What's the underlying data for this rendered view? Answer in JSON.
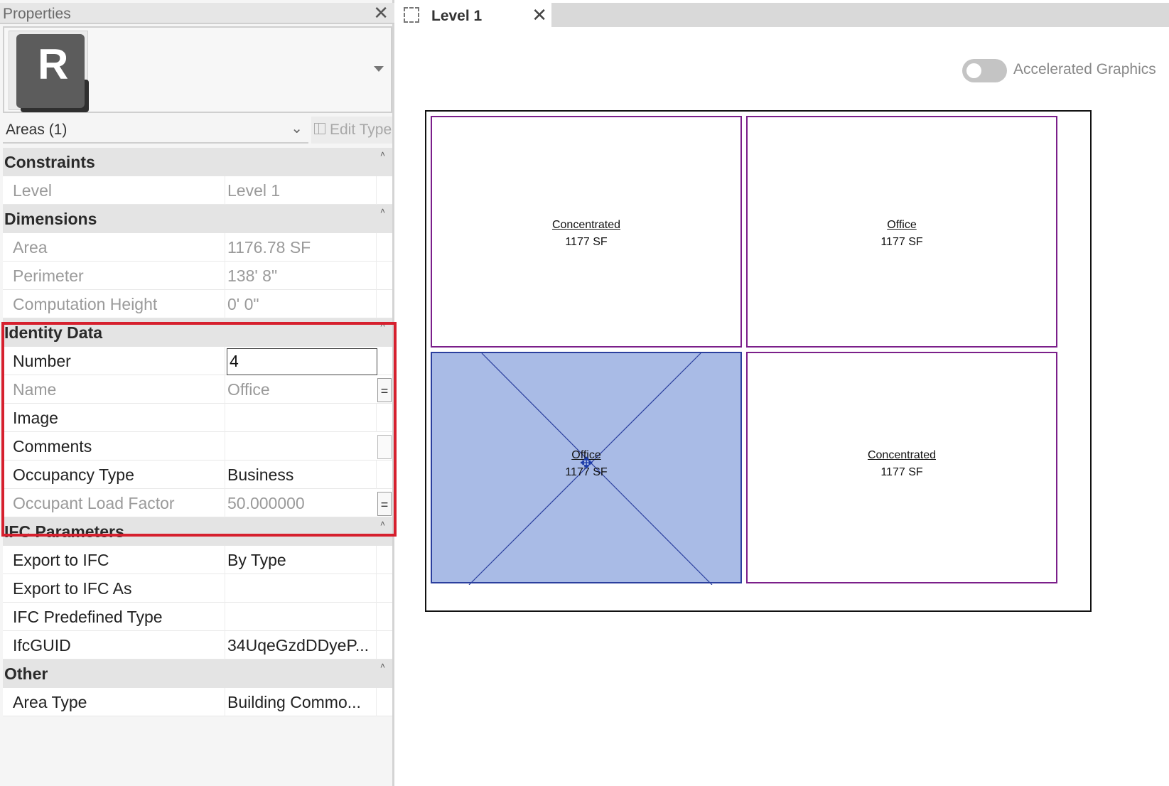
{
  "properties_panel": {
    "title": "Properties",
    "close_icon": "close-icon",
    "type_selector": {
      "logo_letter": "R",
      "dropdown_icon": "caret-down-icon"
    },
    "filter": {
      "label": "Areas (1)",
      "edit_type_label": "Edit Type"
    },
    "groups": [
      {
        "label": "Constraints",
        "rows": [
          {
            "name": "Level",
            "value": "Level 1",
            "readonly": true
          }
        ]
      },
      {
        "label": "Dimensions",
        "rows": [
          {
            "name": "Area",
            "value": "1176.78 SF",
            "readonly": true
          },
          {
            "name": "Perimeter",
            "value": "138'  8\"",
            "readonly": true
          },
          {
            "name": "Computation Height",
            "value": "0'  0\"",
            "readonly": true
          }
        ]
      },
      {
        "label": "Identity Data",
        "rows": [
          {
            "name": "Number",
            "value": "4",
            "readonly": false
          },
          {
            "name": "Name",
            "value": "Office",
            "readonly": true,
            "button": "="
          },
          {
            "name": "Image",
            "value": "",
            "readonly": false
          },
          {
            "name": "Comments",
            "value": "",
            "readonly": false
          },
          {
            "name": "Occupancy Type",
            "value": "Business",
            "readonly": false
          },
          {
            "name": "Occupant Load Factor",
            "value": "50.000000",
            "readonly": true,
            "button": "="
          }
        ]
      },
      {
        "label": "IFC Parameters",
        "rows": [
          {
            "name": "Export to IFC",
            "value": "By Type",
            "readonly": false
          },
          {
            "name": "Export to IFC As",
            "value": "",
            "readonly": false
          },
          {
            "name": "IFC Predefined Type",
            "value": "",
            "readonly": false
          },
          {
            "name": "IfcGUID",
            "value": "34UqeGzdDDyeP...",
            "readonly": false
          }
        ]
      },
      {
        "label": "Other",
        "rows": [
          {
            "name": "Area Type",
            "value": "Building Commo...",
            "readonly": false
          }
        ]
      }
    ],
    "collapse_glyph": "˄"
  },
  "view": {
    "tab_label": "Level 1",
    "tab_icon": "view-plan-icon",
    "accelerated_graphics_label": "Accelerated Graphics",
    "accelerated_graphics_on": false,
    "rooms": [
      {
        "name": "Concentrated",
        "area": "1177 SF",
        "selected": false
      },
      {
        "name": "Office",
        "area": "1177 SF",
        "selected": false
      },
      {
        "name": "Office",
        "area": "1177 SF",
        "selected": true
      },
      {
        "name": "Concentrated",
        "area": "1177 SF",
        "selected": false
      }
    ]
  },
  "colors": {
    "highlight_border": "#d6202e",
    "area_boundary": "#7b1f8a",
    "selection_fill": "#a9bbe6",
    "selection_line": "#2b3f9e"
  }
}
